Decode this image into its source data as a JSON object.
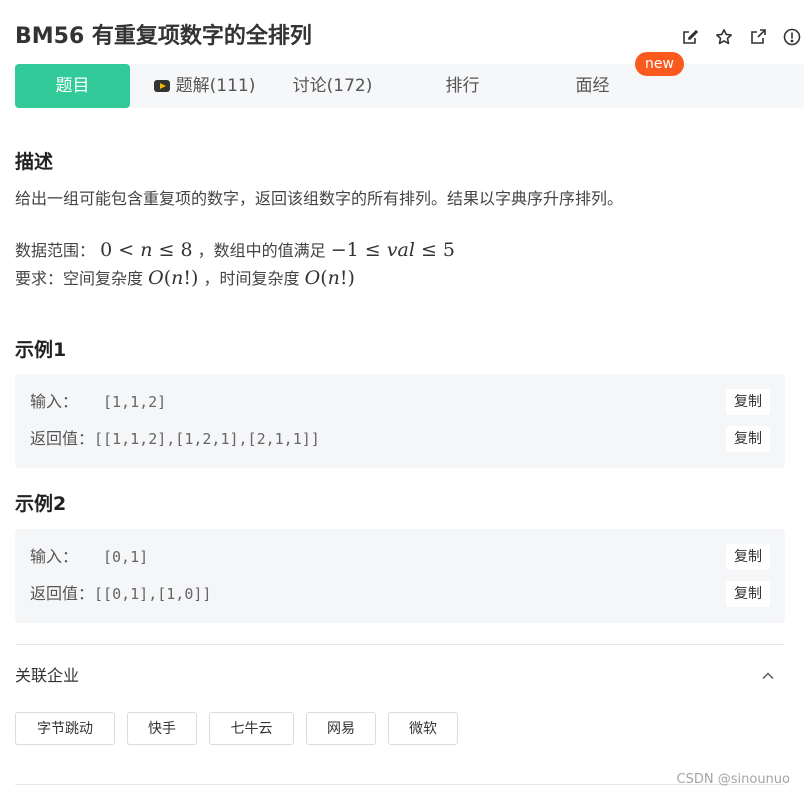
{
  "problem": {
    "title": "BM56  有重复项数字的全排列"
  },
  "header_icons": [
    "edit-icon",
    "star-icon",
    "external-link-icon",
    "report-icon"
  ],
  "tabs": [
    {
      "label": "题目",
      "active": true
    },
    {
      "label": "题解(111)",
      "icon": "video-icon"
    },
    {
      "label": "讨论(172)"
    },
    {
      "label": "排行"
    },
    {
      "label": "面经"
    }
  ],
  "new_badge": "new",
  "description": {
    "heading": "描述",
    "text": "给出一组可能包含重复项的数字，返回该组数字的所有排列。结果以字典序升序排列。",
    "range_label": "数据范围：",
    "range_sep": "，数组中的值满足",
    "req_label": "要求：空间复杂度",
    "req_sep": "，时间复杂度"
  },
  "examples": [
    {
      "heading": "示例1",
      "input_label": "输入：",
      "input": "[1,1,2]",
      "output_label": "返回值：",
      "output": "[[1,1,2],[1,2,1],[2,1,1]]",
      "copy": "复制"
    },
    {
      "heading": "示例2",
      "input_label": "输入：",
      "input": "[0,1]",
      "output_label": "返回值：",
      "output": "[[0,1],[1,0]]",
      "copy": "复制"
    }
  ],
  "companies": {
    "title": "关联企业",
    "tags": [
      "字节跳动",
      "快手",
      "七牛云",
      "网易",
      "微软"
    ]
  },
  "watermark": "CSDN @sinounuo",
  "colors": {
    "accent": "#32ca99",
    "badge": "#fa5a1e",
    "example_bg": "#f5f6f8",
    "tab_bg": "#f6f7f9"
  }
}
